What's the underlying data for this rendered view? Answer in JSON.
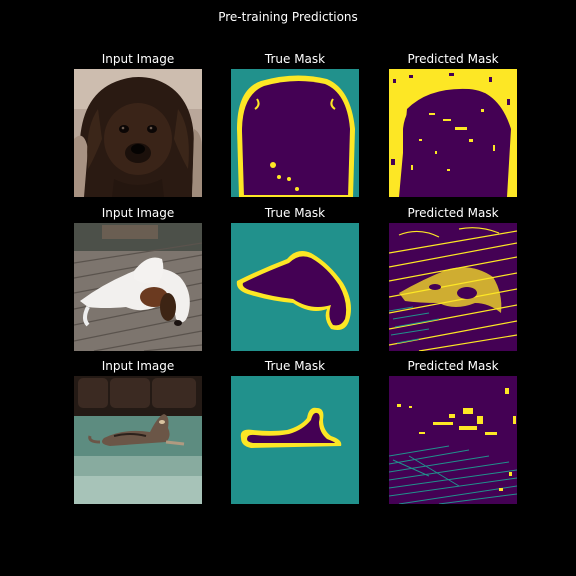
{
  "figure": {
    "title": "Pre-training Predictions"
  },
  "colors": {
    "background": "#000000",
    "purple": "#440154",
    "teal": "#21918c",
    "yellow": "#fde725"
  },
  "rows": [
    {
      "input": {
        "caption": "Input Image",
        "subject": "brown fluffy dog face"
      },
      "true_mask": {
        "caption": "True Mask"
      },
      "pred_mask": {
        "caption": "Predicted Mask"
      }
    },
    {
      "input": {
        "caption": "Input Image",
        "subject": "white and brown dog lying on wooden deck"
      },
      "true_mask": {
        "caption": "True Mask"
      },
      "pred_mask": {
        "caption": "Predicted Mask"
      }
    },
    {
      "input": {
        "caption": "Input Image",
        "subject": "tabby cat lying on green carpet"
      },
      "true_mask": {
        "caption": "True Mask"
      },
      "pred_mask": {
        "caption": "Predicted Mask"
      }
    }
  ]
}
